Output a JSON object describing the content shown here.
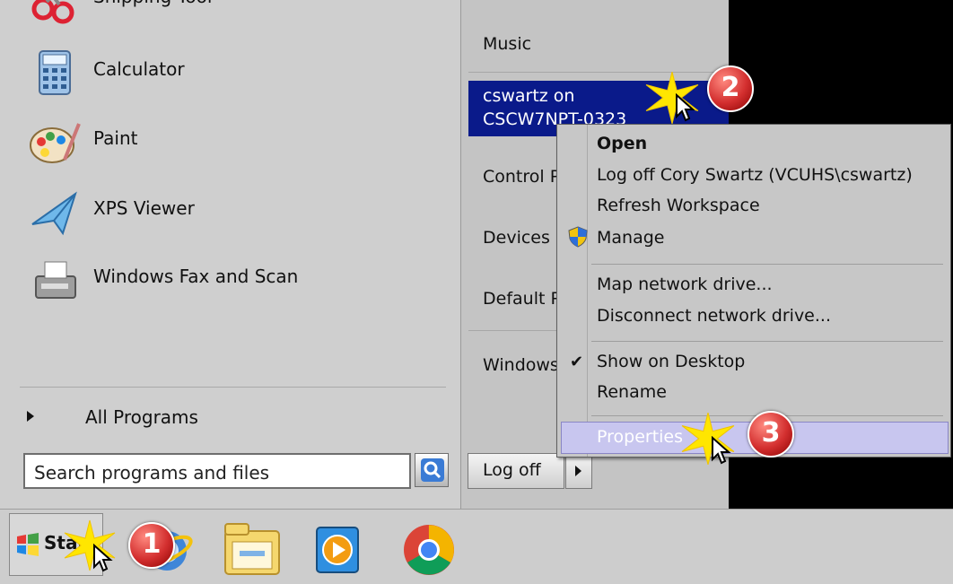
{
  "start_menu": {
    "programs": [
      {
        "label": "Snipping Tool",
        "icon": "scissors-icon"
      },
      {
        "label": "Calculator",
        "icon": "calculator-icon"
      },
      {
        "label": "Paint",
        "icon": "paint-palette-icon"
      },
      {
        "label": "XPS Viewer",
        "icon": "xps-viewer-icon"
      },
      {
        "label": "Windows Fax and Scan",
        "icon": "fax-icon"
      }
    ],
    "all_programs": "All Programs",
    "search_placeholder": "Search programs and files",
    "right_pane": {
      "music": "Music",
      "user_line1": "cswartz on",
      "user_line2": "CSCW7NPT-0323",
      "control_panel": "Control Panel",
      "devices": "Devices and Printers",
      "default_programs": "Default Programs",
      "windows_security": "Windows Security"
    },
    "logoff": "Log off"
  },
  "context_menu": {
    "open": "Open",
    "logoff_user": "Log off Cory Swartz (VCUHS\\cswartz)",
    "refresh": "Refresh Workspace",
    "manage": "Manage",
    "map_drive": "Map network drive...",
    "disconnect_drive": "Disconnect network drive...",
    "show_desktop": "Show on Desktop",
    "rename": "Rename",
    "properties": "Properties"
  },
  "taskbar": {
    "start_label": "Start",
    "apps": [
      "internet-explorer-icon",
      "windows-explorer-icon",
      "media-player-icon",
      "chrome-icon"
    ]
  },
  "annotations": [
    "1",
    "2",
    "3"
  ],
  "colors": {
    "highlight": "#0a1a8a",
    "badge": "#d32f2f",
    "spark": "#ffe600"
  }
}
